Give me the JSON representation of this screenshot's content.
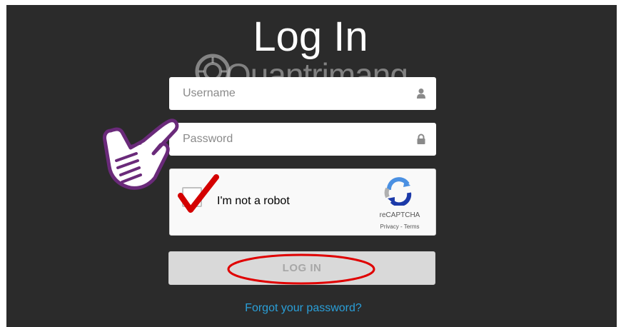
{
  "page": {
    "title": "Log In",
    "watermark": "Quantrimang"
  },
  "form": {
    "username_placeholder": "Username",
    "password_placeholder": "Password",
    "login_label": "LOG IN",
    "forgot_label": "Forgot your password?"
  },
  "captcha": {
    "label": "I'm not a robot",
    "brand": "reCAPTCHA",
    "links": "Privacy - Terms",
    "checked": true
  },
  "icons": {
    "username": "user-icon",
    "password": "lock-icon",
    "recaptcha": "recaptcha-logo-icon",
    "pointer": "pointing-hand-icon"
  },
  "colors": {
    "background": "#2b2b2b",
    "link": "#2a9fd8",
    "annotation": "#e00000",
    "button": "#d9d9d9"
  }
}
